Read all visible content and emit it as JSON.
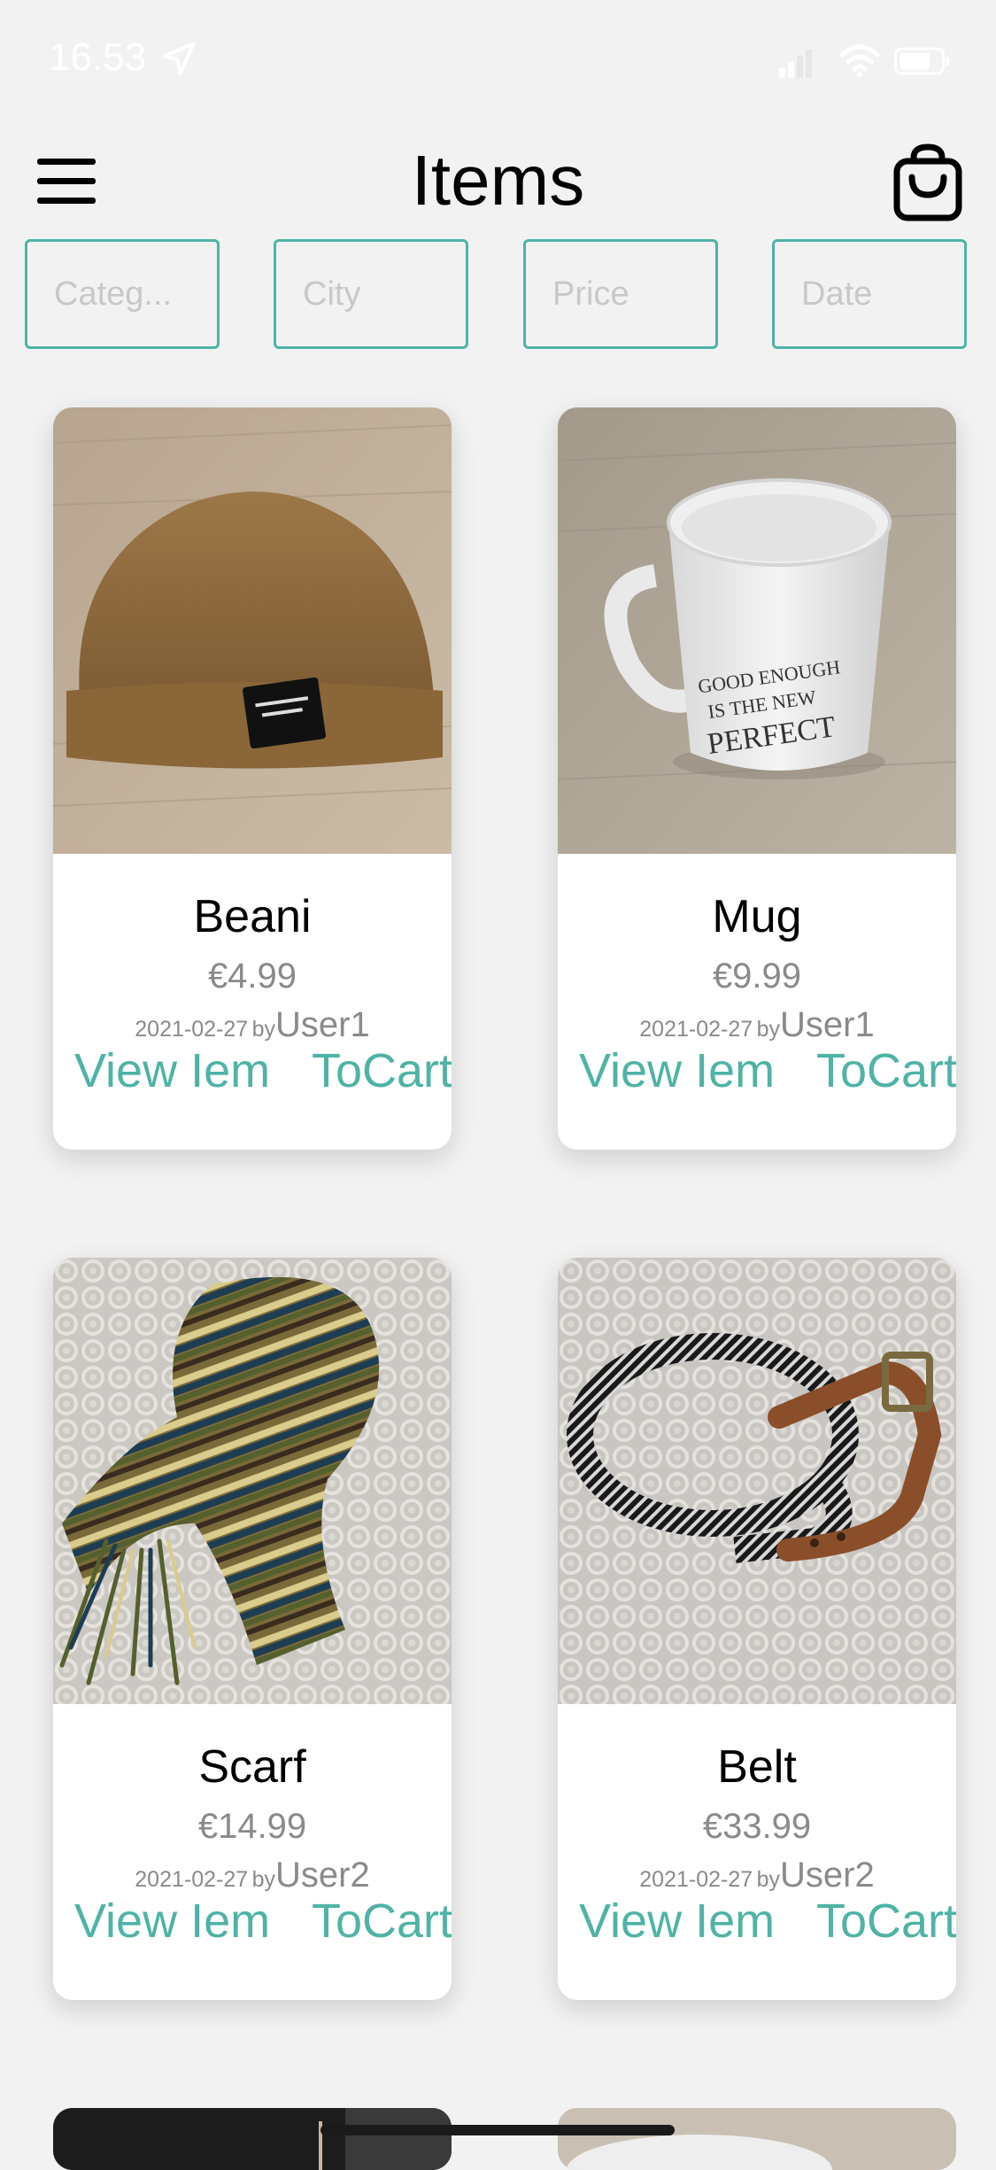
{
  "status_bar": {
    "time": "16.53",
    "icons": [
      "location-arrow-icon",
      "signal-icon",
      "wifi-icon",
      "battery-icon"
    ]
  },
  "header": {
    "title": "Items",
    "menu_icon": "hamburger-menu-icon",
    "cart_icon": "shopping-bag-icon"
  },
  "filters": [
    {
      "placeholder": "Categ..."
    },
    {
      "placeholder": "City"
    },
    {
      "placeholder": "Price"
    },
    {
      "placeholder": "Date"
    }
  ],
  "items": [
    {
      "name": "Beani",
      "price": "€4.99",
      "date": "2021-02-27",
      "by": "by",
      "user": "User1",
      "view_label": "View Iem",
      "cart_label": "ToCart",
      "photo": "beanie-photo"
    },
    {
      "name": "Mug",
      "price": "€9.99",
      "date": "2021-02-27",
      "by": "by",
      "user": "User1",
      "view_label": "View Iem",
      "cart_label": "ToCart",
      "photo": "mug-photo"
    },
    {
      "name": "Scarf",
      "price": "€14.99",
      "date": "2021-02-27",
      "by": "by",
      "user": "User2",
      "view_label": "View Iem",
      "cart_label": "ToCart",
      "photo": "scarf-photo"
    },
    {
      "name": "Belt",
      "price": "€33.99",
      "date": "2021-02-27",
      "by": "by",
      "user": "User2",
      "view_label": "View Iem",
      "cart_label": "ToCart",
      "photo": "belt-photo"
    }
  ],
  "colors": {
    "accent": "#4fb3a6",
    "background": "#f2f2f2",
    "muted_text": "#8a8a8a"
  }
}
